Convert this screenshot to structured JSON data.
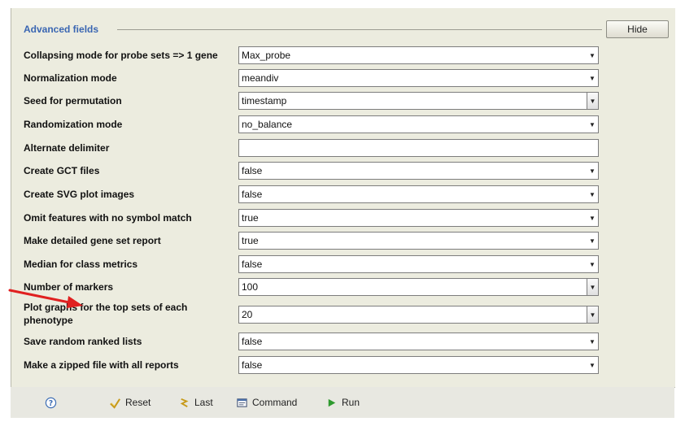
{
  "section": {
    "title": "Advanced fields",
    "hide_label": "Hide"
  },
  "fields": [
    {
      "label": "Collapsing mode for probe sets => 1 gene",
      "value": "Max_probe",
      "kind": "select"
    },
    {
      "label": "Normalization mode",
      "value": "meandiv",
      "kind": "select"
    },
    {
      "label": "Seed for permutation",
      "value": "timestamp",
      "kind": "combo"
    },
    {
      "label": "Randomization mode",
      "value": "no_balance",
      "kind": "select"
    },
    {
      "label": "Alternate delimiter",
      "value": "",
      "kind": "text"
    },
    {
      "label": "Create GCT files",
      "value": "false",
      "kind": "select"
    },
    {
      "label": "Create SVG plot images",
      "value": "false",
      "kind": "select"
    },
    {
      "label": "Omit features with no symbol match",
      "value": "true",
      "kind": "select"
    },
    {
      "label": "Make detailed gene set report",
      "value": "true",
      "kind": "select"
    },
    {
      "label": "Median for class metrics",
      "value": "false",
      "kind": "select"
    },
    {
      "label": "Number of markers",
      "value": "100",
      "kind": "combo"
    },
    {
      "label": "Plot graphs for the top sets of each phenotype",
      "value": "20",
      "kind": "combo"
    },
    {
      "label": "Save random ranked lists",
      "value": "false",
      "kind": "select"
    },
    {
      "label": "Make a zipped file with all reports",
      "value": "false",
      "kind": "select"
    }
  ],
  "toolbar": {
    "help_icon": "help-icon",
    "reset_label": "Reset",
    "last_label": "Last",
    "command_label": "Command",
    "run_label": "Run"
  },
  "colors": {
    "panel_bg": "#ececdf",
    "section_title": "#3a66b2",
    "annotation_arrow": "#e02020",
    "run_icon": "#2e9a2e"
  }
}
